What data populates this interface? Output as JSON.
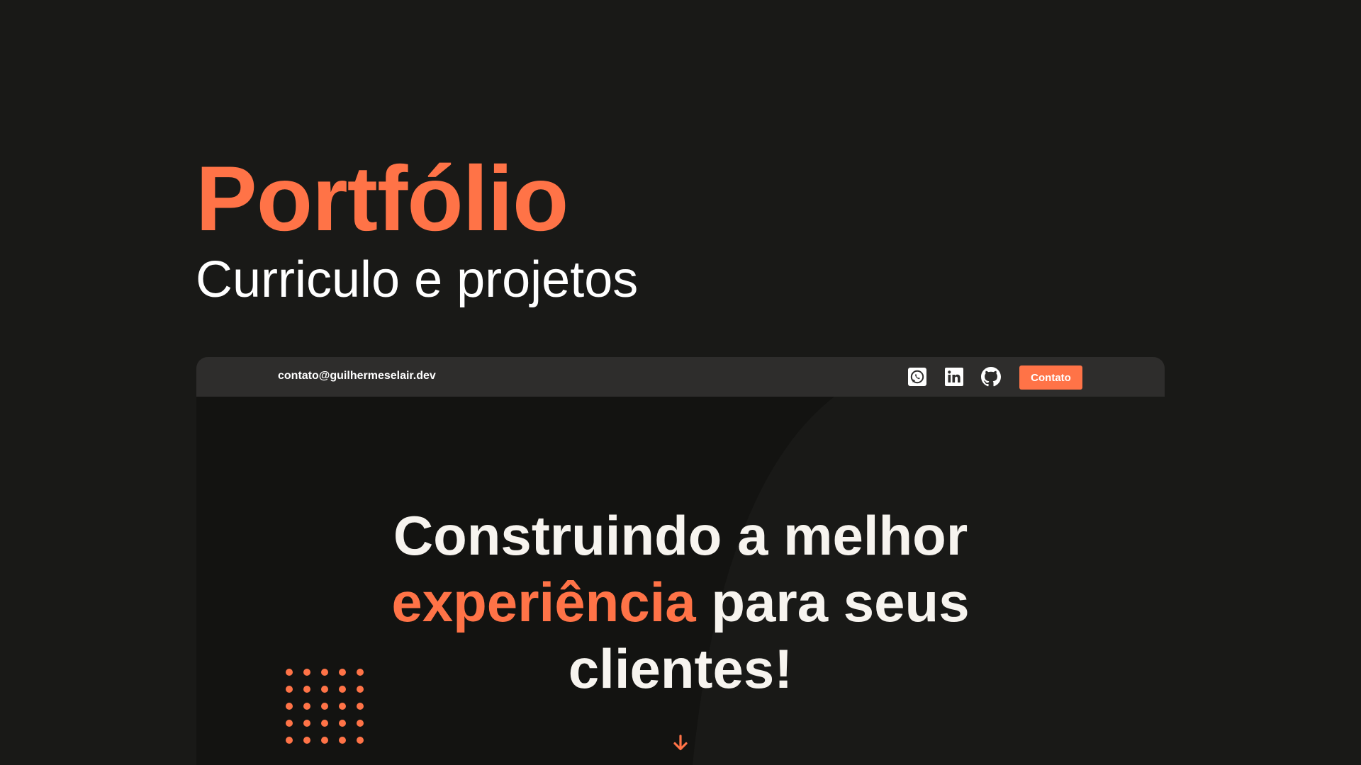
{
  "colors": {
    "background": "#191917",
    "accent": "#FF7347",
    "text": "#FFFFFF",
    "topbar": "#2E2D2C",
    "preview_bg": "#131311"
  },
  "hero": {
    "title": "Portfólio",
    "subtitle": "Curriculo e projetos"
  },
  "preview": {
    "topbar": {
      "email": "contato@guilhermeselair.dev",
      "social_icons": [
        "whatsapp-icon",
        "linkedin-icon",
        "github-icon"
      ],
      "contact_button_label": "Contato"
    },
    "headline": {
      "line1": "Construindo a melhor",
      "accent_word": "experiência",
      "line2_rest": "para seus",
      "line3": "clientes!"
    },
    "decor_icons": [
      "dot-grid-decoration",
      "arrow-down-icon"
    ]
  }
}
